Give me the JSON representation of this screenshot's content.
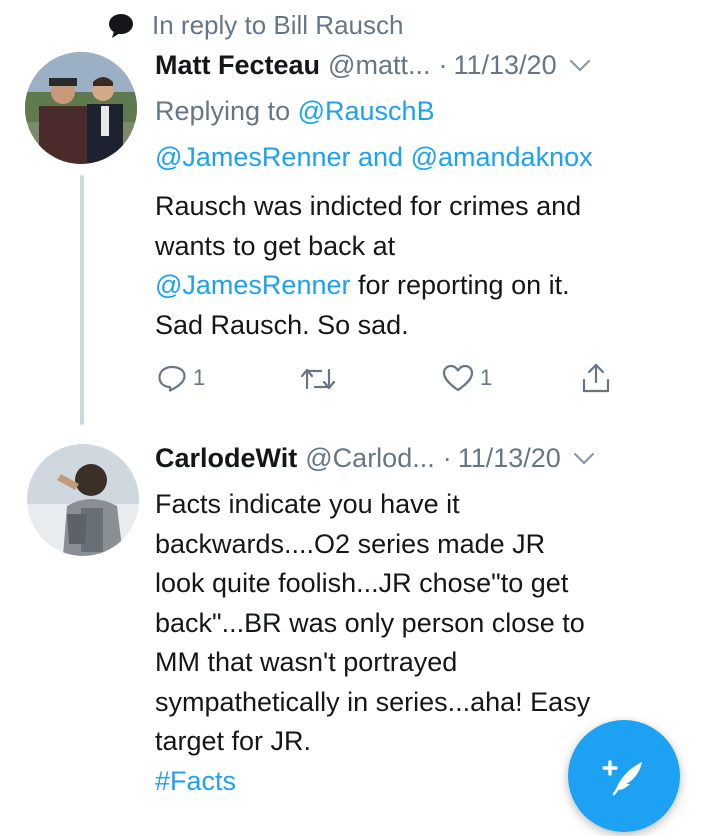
{
  "context": {
    "reply_to_text": "In reply to Bill Rausch"
  },
  "tweets": [
    {
      "name": "Matt Fecteau",
      "handle": "@matt...",
      "sep": "·",
      "date": "11/13/20",
      "replying_prefix": "Replying to",
      "replying_user1": "@RauschB",
      "replying_user2": "@JamesRenner",
      "replying_and": "and",
      "replying_user3": "@amandaknox",
      "body_line1": "Rausch was indicted for crimes and",
      "body_line2": "wants to get back at",
      "body_mention": "@JamesRenner",
      "body_line3_rest": " for reporting on it.",
      "body_line4": "Sad Rausch. So sad.",
      "reply_count": "1",
      "like_count": "1"
    },
    {
      "name": "CarlodeWit",
      "handle": "@Carlod...",
      "sep": "·",
      "date": "11/13/20",
      "body_lines": [
        "Facts indicate you have it",
        "backwards....O2 series made JR",
        "look quite foolish...JR chose\"to get",
        "back\"...BR was only person close to",
        "MM that wasn't portrayed",
        "sympathetically in series...aha! Easy",
        "target for JR."
      ],
      "hashtag": "#Facts"
    }
  ],
  "icons": {
    "reply": "reply-icon",
    "retweet": "retweet-icon",
    "like": "heart-icon",
    "share": "share-icon",
    "compose": "compose-tweet-icon"
  },
  "colors": {
    "accent": "#1da1f2",
    "muted": "#657786",
    "text": "#14171a"
  }
}
